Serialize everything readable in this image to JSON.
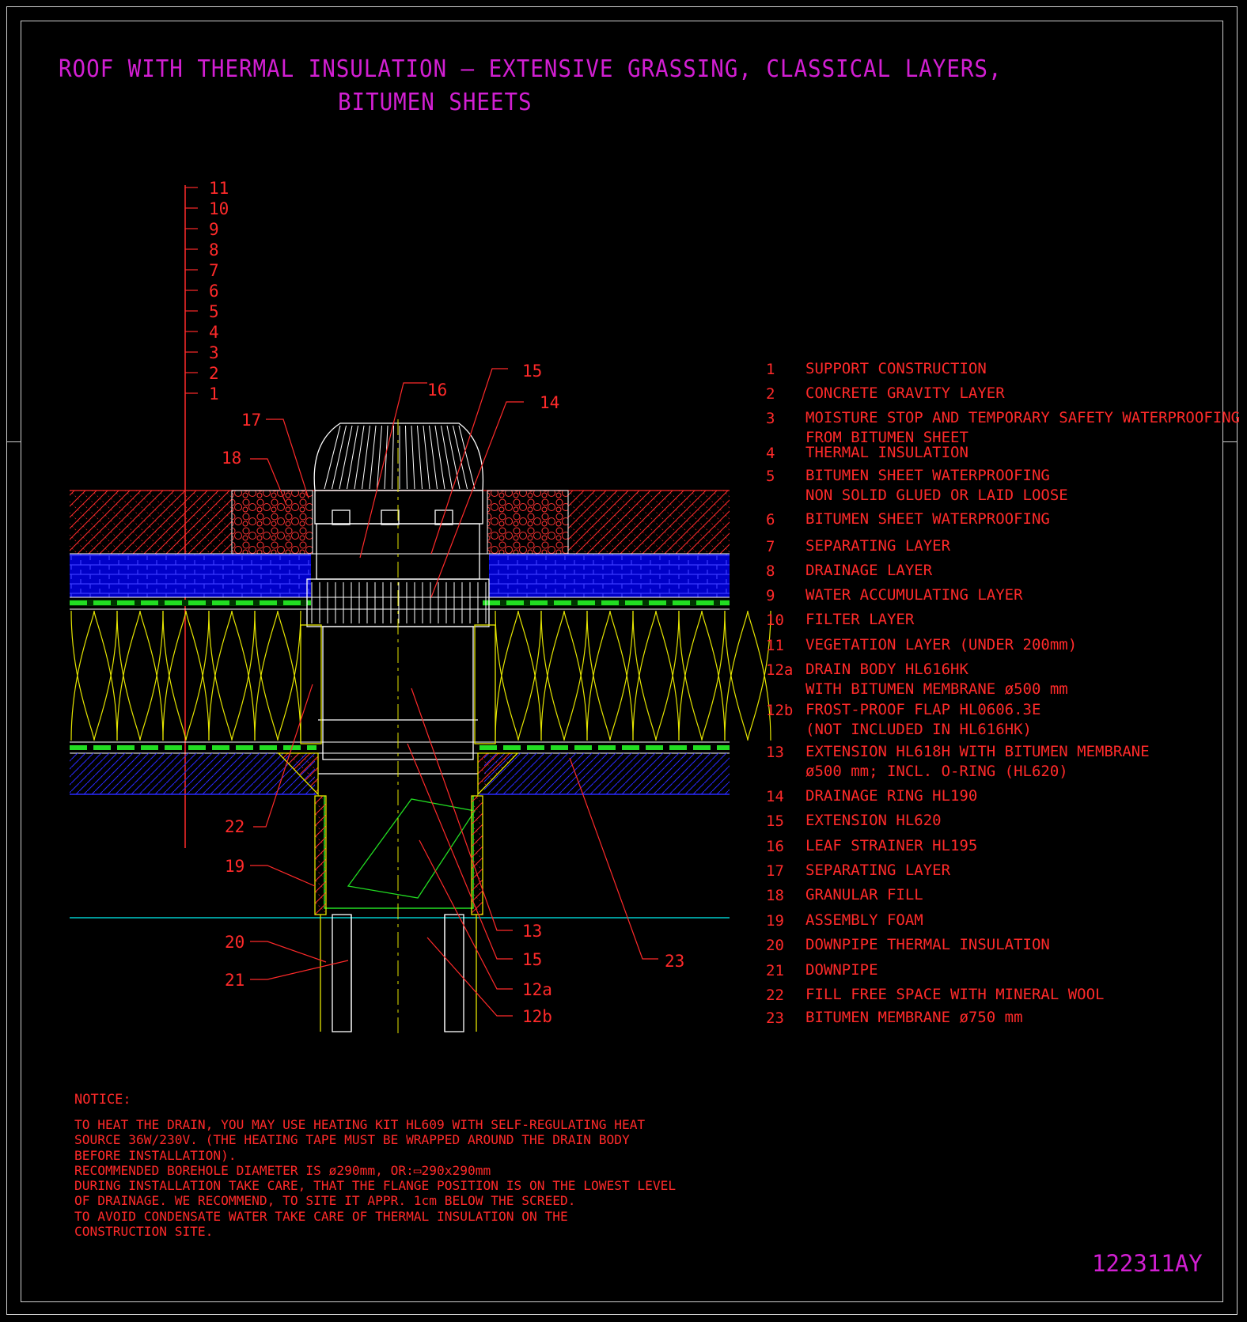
{
  "title": {
    "line1": "ROOF WITH THERMAL INSULATION – EXTENSIVE GRASSING, CLASSICAL LAYERS,",
    "line2": "BITUMEN SHEETS"
  },
  "layer_scale": [
    "11",
    "10",
    "9",
    "8",
    "7",
    "6",
    "5",
    "4",
    "3",
    "2",
    "1"
  ],
  "callouts": {
    "c13": "13",
    "c14": "14",
    "c15a": "15",
    "c15b": "15",
    "c16": "16",
    "c17": "17",
    "c18": "18",
    "c19": "19",
    "c20": "20",
    "c21": "21",
    "c22": "22",
    "c23": "23",
    "c12a": "12a",
    "c12b": "12b"
  },
  "legend": [
    {
      "num": "1",
      "text": "SUPPORT CONSTRUCTION"
    },
    {
      "num": "2",
      "text": "CONCRETE GRAVITY LAYER"
    },
    {
      "num": "3",
      "text": "MOISTURE STOP AND TEMPORARY SAFETY WATERPROOFING",
      "text2": "FROM BITUMEN SHEET"
    },
    {
      "num": "4",
      "text": "THERMAL INSULATION"
    },
    {
      "num": "5",
      "text": "BITUMEN SHEET WATERPROOFING",
      "text2": "NON SOLID GLUED OR LAID LOOSE"
    },
    {
      "num": "6",
      "text": "BITUMEN SHEET WATERPROOFING"
    },
    {
      "num": "7",
      "text": "SEPARATING LAYER"
    },
    {
      "num": "8",
      "text": "DRAINAGE LAYER"
    },
    {
      "num": "9",
      "text": "WATER ACCUMULATING LAYER"
    },
    {
      "num": "10",
      "text": "FILTER LAYER"
    },
    {
      "num": "11",
      "text": "VEGETATION LAYER (UNDER 200mm)"
    },
    {
      "num": "12a",
      "text": "DRAIN BODY HL616HK",
      "text2": "WITH BITUMEN MEMBRANE ø500 mm"
    },
    {
      "num": "12b",
      "text": "FROST-PROOF FLAP HL0606.3E",
      "text2": "(NOT INCLUDED IN HL616HK)"
    },
    {
      "num": "13",
      "text": "EXTENSION HL618H WITH BITUMEN MEMBRANE",
      "text2": "ø500 mm; INCL. O-RING (HL620)"
    },
    {
      "num": "14",
      "text": "DRAINAGE RING HL190"
    },
    {
      "num": "15",
      "text": "EXTENSION HL620"
    },
    {
      "num": "16",
      "text": "LEAF STRAINER HL195"
    },
    {
      "num": "17",
      "text": "SEPARATING LAYER"
    },
    {
      "num": "18",
      "text": "GRANULAR FILL"
    },
    {
      "num": "19",
      "text": "ASSEMBLY FOAM"
    },
    {
      "num": "20",
      "text": "DOWNPIPE THERMAL INSULATION"
    },
    {
      "num": "21",
      "text": "DOWNPIPE"
    },
    {
      "num": "22",
      "text": "FILL FREE SPACE WITH MINERAL WOOL"
    },
    {
      "num": "23",
      "text": "BITUMEN MEMBRANE ø750 mm"
    }
  ],
  "notice": {
    "title": "NOTICE:",
    "lines": [
      "TO HEAT THE DRAIN, YOU MAY USE HEATING KIT HL609 WITH SELF-REGULATING HEAT",
      "SOURCE 36W/230V. (THE HEATING TAPE MUST BE WRAPPED AROUND THE DRAIN BODY",
      "BEFORE INSTALLATION).",
      "RECOMMENDED BOREHOLE DIAMETER IS ø290mm, OR:▭290x290mm",
      "DURING INSTALLATION TAKE CARE, THAT THE FLANGE POSITION IS ON THE LOWEST LEVEL",
      "OF DRAINAGE. WE RECOMMEND, TO SITE IT APPR. 1cm BELOW THE SCREED.",
      "TO AVOID CONDENSATE WATER TAKE CARE OF THERMAL INSULATION ON THE",
      "CONSTRUCTION SITE."
    ]
  },
  "drawing_code": "122311AY",
  "colors": {
    "title": "#d21fd2",
    "text": "#ff2a2a",
    "insulation": "#e6e600",
    "membrane": "#22dd22",
    "drainage": "#1a1aff",
    "gravel": "#ff3333",
    "drain_body": "#ffffff",
    "base_line": "#00cccc"
  }
}
